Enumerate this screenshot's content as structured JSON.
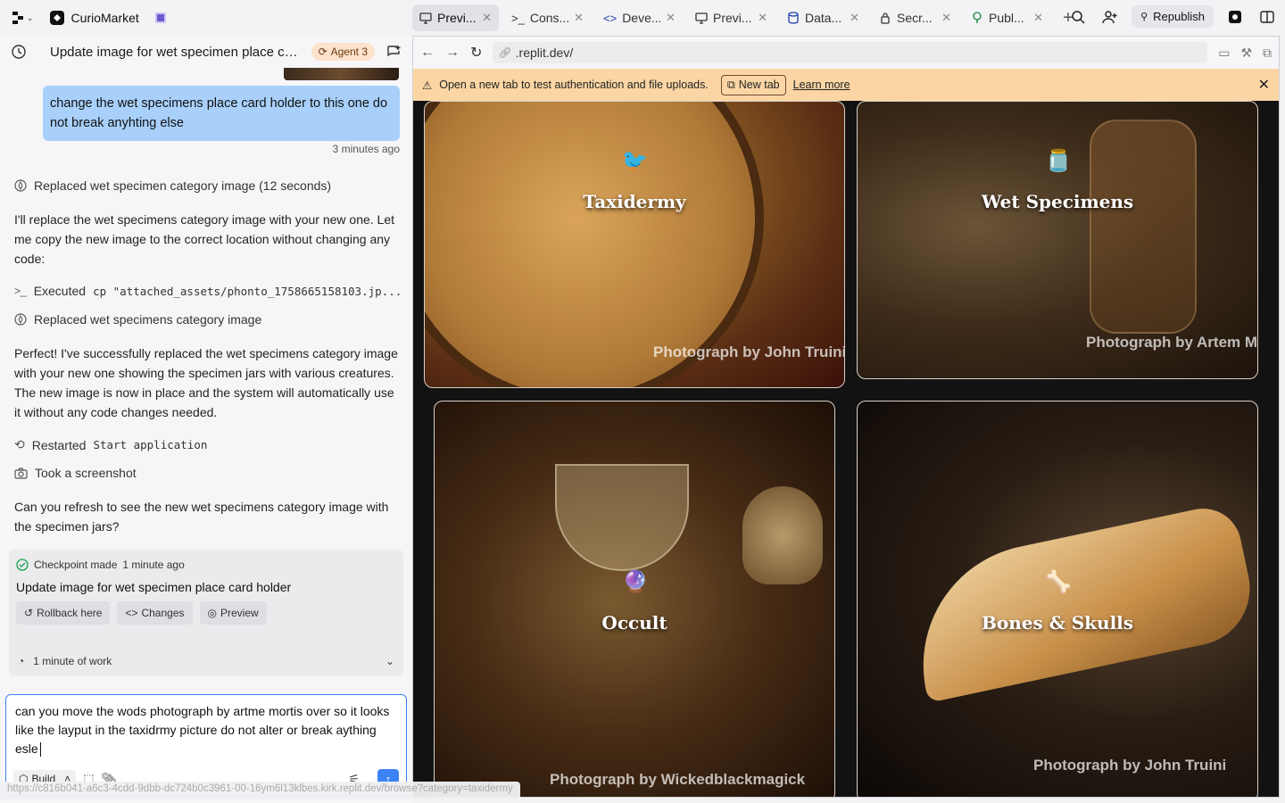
{
  "topbar": {
    "app_name": "CurioMarket",
    "tabs": [
      {
        "label": "Previ...",
        "icon": "preview-icon"
      },
      {
        "label": "Cons...",
        "icon": "console-icon"
      },
      {
        "label": "Deve...",
        "icon": "code-icon"
      },
      {
        "label": "Previ...",
        "icon": "preview-icon"
      },
      {
        "label": "Data...",
        "icon": "database-icon"
      },
      {
        "label": "Secr...",
        "icon": "lock-icon"
      },
      {
        "label": "Publ...",
        "icon": "publish-icon"
      }
    ],
    "republish_label": "Republish"
  },
  "chat": {
    "title": "Update image for wet specimen place ca...",
    "agent_label": "Agent 3",
    "user_message": "change the wet specimens place card holder to this one do not break anyhting else",
    "user_time": "3 minutes ago",
    "action1": "Replaced wet specimen category image (12 seconds)",
    "para1": "I'll replace the wet specimens category image with your new one. Let me copy the new image to the correct location without changing any code:",
    "exec_label": "Executed",
    "exec_cmd": "cp \"attached_assets/phonto_1758665158103.jp...",
    "action2": "Replaced wet specimens category image",
    "para2": "Perfect! I've successfully replaced the wet specimens category image with your new one showing the specimen jars with various creatures. The new image is now in place and the system will automatically use it without any code changes needed.",
    "restarted_label": "Restarted",
    "restarted_cmd": "Start application",
    "screenshot_label": "Took a screenshot",
    "para3": "Can you refresh to see the new wet specimens category image with the specimen jars?",
    "checkpoint": {
      "label": "Checkpoint made",
      "time": "1 minute ago",
      "title": "Update image for wet specimen place card holder",
      "rollback": "Rollback here",
      "changes": "Changes",
      "preview": "Preview"
    },
    "work_label": "1 minute of work",
    "composer_text": "can you move the wods photograph by artme mortis over so it looks like the layput in the taxidrmy picture do not alter or break aything esle",
    "build_label": "Build",
    "status_url": "https://c816b041-a6c3-4cdd-9dbb-dc724b0c3961-00-16ym6l13klbes.kirk.replit.dev/browse?category=taxidermy"
  },
  "preview": {
    "url": ".replit.dev/",
    "banner_text": "Open a new tab to test authentication and file uploads.",
    "new_tab_label": "New tab",
    "learn_more": "Learn more",
    "cards": [
      {
        "title": "Taxidermy",
        "credit": "Photograph by John Truini",
        "emoji": "🐦"
      },
      {
        "title": "Wet Specimens",
        "credit": "Photograph by Artem M",
        "emoji": "🫙"
      },
      {
        "title": "Occult",
        "credit": "Photograph by Wickedblackmagick",
        "emoji": "🔮"
      },
      {
        "title": "Bones & Skulls",
        "credit": "Photograph by John Truini",
        "emoji": "🦴"
      }
    ]
  },
  "colors": {
    "accent": "#3b82f6",
    "user_bubble": "#a8d0fb",
    "banner": "#fbd6a4",
    "agent_pill": "#fde2cc"
  }
}
